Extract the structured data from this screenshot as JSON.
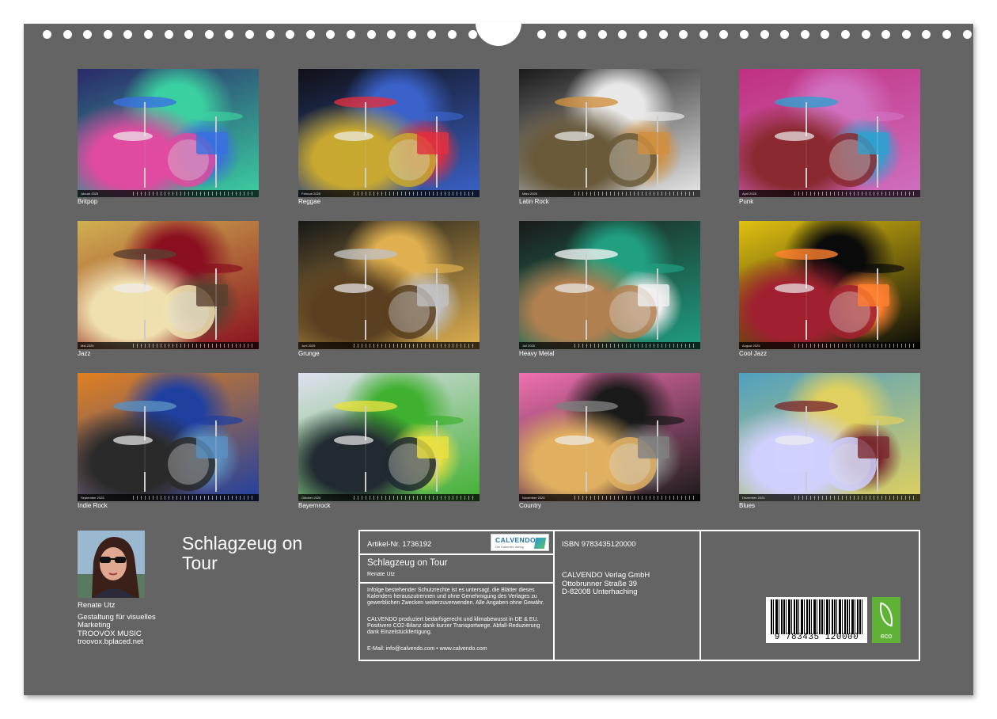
{
  "calendar": {
    "months": [
      {
        "caption": "Britpop",
        "month": "Januar 2025",
        "colors": [
          "#2a2a6a",
          "#3bd0a0",
          "#e04aa0",
          "#3a70e0"
        ]
      },
      {
        "caption": "Reggae",
        "month": "Februar 2025",
        "colors": [
          "#101015",
          "#3a62c8",
          "#c8a830",
          "#e03040"
        ]
      },
      {
        "caption": "Latin Rock",
        "month": "März 2025",
        "colors": [
          "#1a1a1a",
          "#e8e8e8",
          "#6a5a3a",
          "#d09040"
        ]
      },
      {
        "caption": "Punk",
        "month": "April 2025",
        "colors": [
          "#c03080",
          "#d070c0",
          "#8a2a30",
          "#30a0d0"
        ]
      },
      {
        "caption": "Jazz",
        "month": "Mai 2025",
        "colors": [
          "#d0b050",
          "#8a1020",
          "#f0e0b0",
          "#5a4030"
        ]
      },
      {
        "caption": "Grunge",
        "month": "Juni 2025",
        "colors": [
          "#181818",
          "#e0b050",
          "#5a4020",
          "#c0c0c0"
        ]
      },
      {
        "caption": "Heavy Metal",
        "month": "Juli 2025",
        "colors": [
          "#1a1a1a",
          "#20a080",
          "#b08050",
          "#f0f0f0"
        ]
      },
      {
        "caption": "Cool Jazz",
        "month": "August 2025",
        "colors": [
          "#e0c010",
          "#0a0a0a",
          "#a02030",
          "#ff8030"
        ]
      },
      {
        "caption": "Indie Rock",
        "month": "September 2025",
        "colors": [
          "#e08020",
          "#2040a0",
          "#2a2a2a",
          "#5a90c0"
        ]
      },
      {
        "caption": "Bayernrock",
        "month": "Oktober 2025",
        "colors": [
          "#e0e0f0",
          "#40b030",
          "#202a30",
          "#e8e040"
        ]
      },
      {
        "caption": "Country",
        "month": "November 2025",
        "colors": [
          "#f070b0",
          "#1a1a1a",
          "#e0b060",
          "#808080"
        ]
      },
      {
        "caption": "Blues",
        "month": "Dezember 2025",
        "colors": [
          "#50a0c0",
          "#e0d060",
          "#d0d0ff",
          "#7a2a30"
        ]
      }
    ]
  },
  "author": {
    "name": "Renate Utz",
    "line2": "Gestaltung für visuelles",
    "line3": "Marketing",
    "line4": "TROOVOX MUSIC",
    "line5": "troovox.bplaced.net"
  },
  "title": {
    "line1": "Schlagzeug on",
    "line2": "Tour"
  },
  "info": {
    "article": "Artikel-Nr. 1736192",
    "book_title": "Schlagzeug on Tour",
    "book_author": "Renate Utz",
    "legal": "Infolge bestehender Schutzrechte ist es untersagt, die Blätter dieses Kalenders herauszutrennen und ohne Genehmigung des Verlages zu gewerblichen Zwecken weiterzuverwenden. Alle Angaben ohne Gewähr.",
    "eco_note": "CALVENDO produziert bedarfsgerecht und klimabewusst in DE & EU. Positivere CO2-Bilanz dank kurzer Transportwege. Abfall-Reduzierung dank Einzelstückfertigung.",
    "contact": "E-Mail: info@calvendo.com • www.calvendo.com",
    "isbn": "ISBN 9783435120000",
    "publisher": "CALVENDO Verlag GmbH",
    "street": "Ottobrunner Straße 39",
    "city": "D-82008 Unterhaching",
    "logo_name": "CALVENDO",
    "logo_tag": "Die Kalender-Verlag",
    "barcode_number": "9 783435 120000",
    "eco_label": "eco"
  }
}
